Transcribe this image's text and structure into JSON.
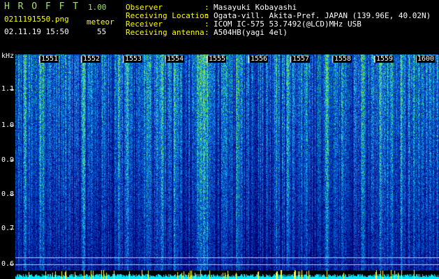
{
  "app": {
    "name": "H R O F F T",
    "version": "1.00"
  },
  "file": {
    "name": "0211191550.png",
    "datetime": "02.11.19 15:50"
  },
  "meteor": {
    "label": "meteor",
    "count": "55"
  },
  "info": [
    {
      "key": "Observer",
      "sep": ":",
      "value": "Masayuki Kobayashi"
    },
    {
      "key": "Receiving Location",
      "sep": ":",
      "value": "Ogata-vill. Akita-Pref. JAPAN (139.96E, 40.02N)"
    },
    {
      "key": "Receiver",
      "sep": ":",
      "value": "ICOM IC-575 53.7492(@LCD)MHz USB"
    },
    {
      "key": "Receiving antenna",
      "sep": ":",
      "value": "A504HB(yagi 4el)"
    }
  ],
  "spectrogram": {
    "y_unit": "kHz",
    "y_ticks": [
      "1.1",
      "1.0",
      "0.9",
      "0.8",
      "0.7",
      "0.6"
    ],
    "x_ticks": [
      "1551",
      "1552",
      "1553",
      "1554",
      "1555",
      "1556",
      "1557",
      "1558",
      "1559",
      "1600"
    ],
    "colors": {
      "low": "#00008a",
      "mid": "#2060ff",
      "high": "#30e070",
      "peak": "#ffff40",
      "baseline": "#00ffff"
    }
  }
}
